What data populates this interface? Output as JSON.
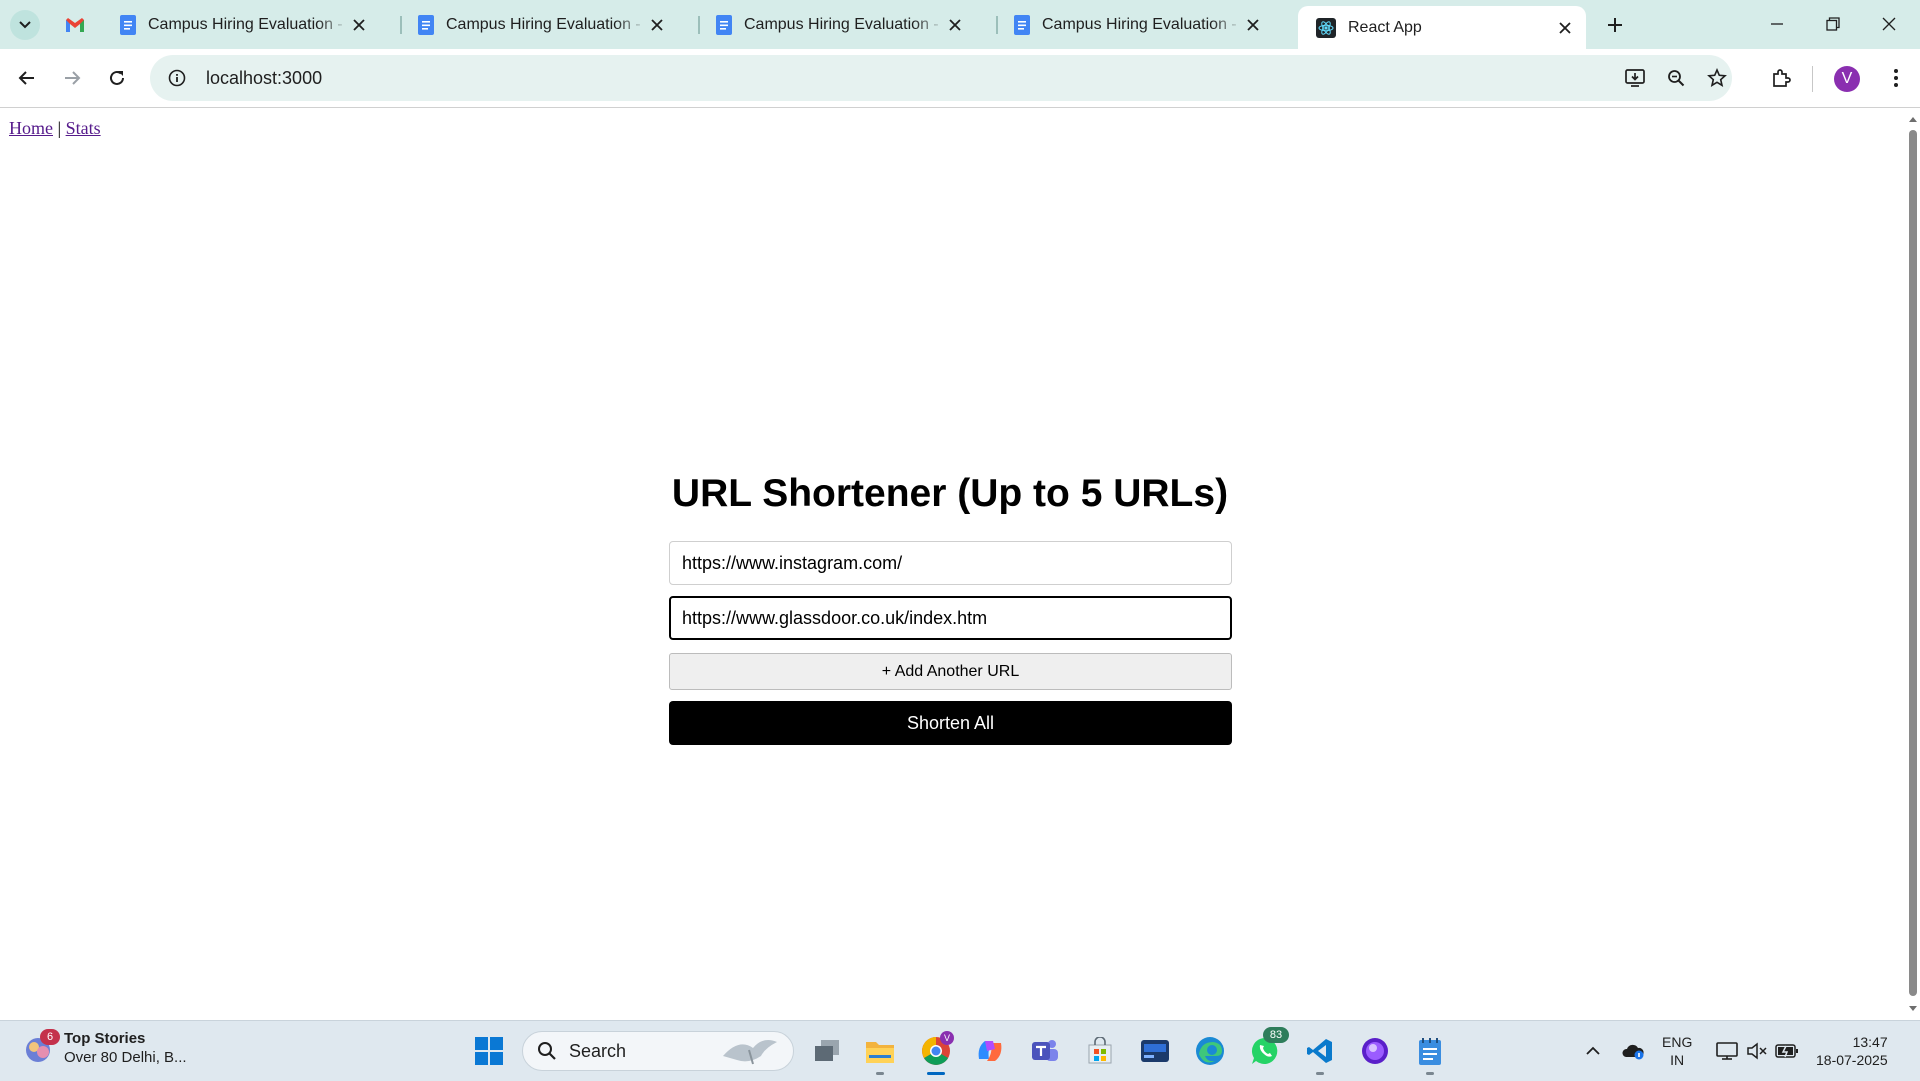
{
  "browser": {
    "tabs": [
      {
        "title": "Campus Hiring Evaluation - Fro",
        "favicon": "docs-icon"
      },
      {
        "title": "Campus Hiring Evaluation - Bac",
        "favicon": "docs-icon"
      },
      {
        "title": "Campus Hiring Evaluation - Pre",
        "favicon": "docs-icon"
      },
      {
        "title": "Campus Hiring Evaluation - Full",
        "favicon": "docs-icon"
      },
      {
        "title": "React App",
        "favicon": "react-icon",
        "active": true
      }
    ],
    "address": "localhost:3000",
    "profile_initial": "V",
    "accent": "#d6ece9"
  },
  "page": {
    "nav": {
      "home": "Home",
      "separator": "|",
      "stats": "Stats"
    },
    "heading": "URL Shortener (Up to 5 URLs)",
    "urls": [
      "https://www.instagram.com/",
      "https://www.glassdoor.co.uk/index.htm"
    ],
    "add_button": "+ Add Another URL",
    "submit_button": "Shorten All"
  },
  "taskbar": {
    "news_badge": "6",
    "news_title": "Top Stories",
    "news_subtitle": "Over 80 Delhi, B...",
    "search_label": "Search",
    "whatsapp_badge": "83",
    "lang_line1": "ENG",
    "lang_line2": "IN",
    "time": "13:47",
    "date": "18-07-2025"
  }
}
